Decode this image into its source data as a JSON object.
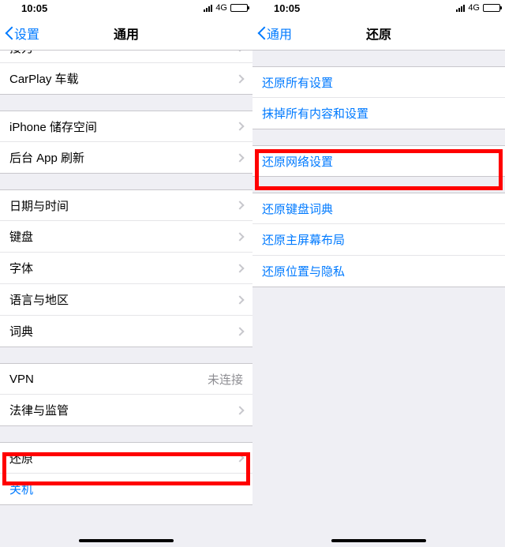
{
  "status": {
    "time": "10:05",
    "network": "4G"
  },
  "left": {
    "back": "设置",
    "title": "通用",
    "groups": [
      [
        {
          "label": "接力",
          "chevron": true
        },
        {
          "label": "CarPlay 车载",
          "chevron": true
        }
      ],
      [
        {
          "label": "iPhone 储存空间",
          "chevron": true
        },
        {
          "label": "后台 App 刷新",
          "chevron": true
        }
      ],
      [
        {
          "label": "日期与时间",
          "chevron": true
        },
        {
          "label": "键盘",
          "chevron": true
        },
        {
          "label": "字体",
          "chevron": true
        },
        {
          "label": "语言与地区",
          "chevron": true
        },
        {
          "label": "词典",
          "chevron": true
        }
      ],
      [
        {
          "label": "VPN",
          "detail": "未连接"
        },
        {
          "label": "法律与监管",
          "chevron": true
        }
      ],
      [
        {
          "label": "还原",
          "chevron": true
        },
        {
          "label": "关机",
          "blue": true
        }
      ]
    ]
  },
  "right": {
    "back": "通用",
    "title": "还原",
    "groups": [
      [
        {
          "label": "还原所有设置",
          "blue": true
        },
        {
          "label": "抹掉所有内容和设置",
          "blue": true
        }
      ],
      [
        {
          "label": "还原网络设置",
          "blue": true
        }
      ],
      [
        {
          "label": "还原键盘词典",
          "blue": true
        },
        {
          "label": "还原主屏幕布局",
          "blue": true
        },
        {
          "label": "还原位置与隐私",
          "blue": true
        }
      ]
    ]
  }
}
